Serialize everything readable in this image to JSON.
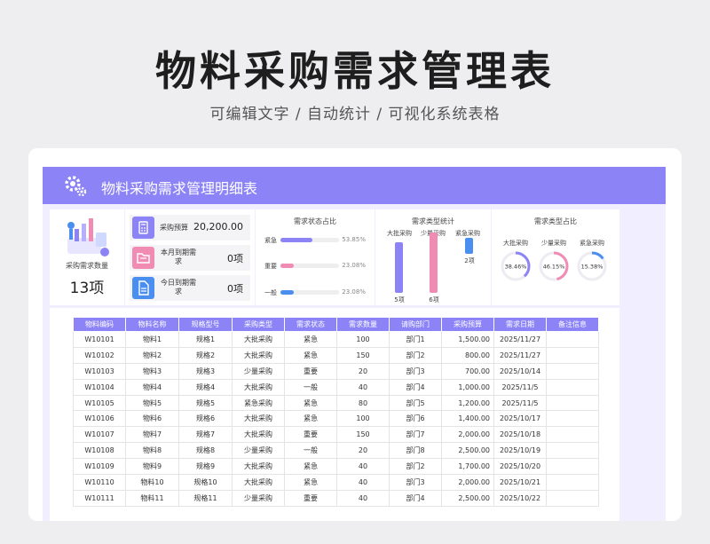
{
  "page": {
    "title": "物料采购需求管理表",
    "subtitle": "可编辑文字 / 自动统计 / 可视化系统表格"
  },
  "banner": {
    "title": "物料采购需求管理明细表"
  },
  "kpi": {
    "label": "采购需求数量",
    "value": "13项"
  },
  "stats": [
    {
      "label": "采购预算",
      "value": "20,200.00",
      "color": "#8c83f6",
      "icon": "calculator-icon"
    },
    {
      "label": "本月到期需求",
      "value": "0项",
      "color": "#f08bb4",
      "icon": "folder-icon"
    },
    {
      "label": "今日到期需求",
      "value": "0项",
      "color": "#4a8ff0",
      "icon": "document-icon"
    }
  ],
  "status_chart": {
    "title": "需求状态占比",
    "items": [
      {
        "label": "紧急",
        "percent": "53.85%",
        "value": 53.85,
        "color": "#8c83f6"
      },
      {
        "label": "重要",
        "percent": "23.08%",
        "value": 23.08,
        "color": "#f08bb4"
      },
      {
        "label": "一般",
        "percent": "23.08%",
        "value": 23.08,
        "color": "#4a8ff0"
      }
    ]
  },
  "type_chart": {
    "title": "需求类型统计",
    "items": [
      {
        "label": "大批采购",
        "count": 5,
        "value_label": "5项",
        "color": "#8c83f6"
      },
      {
        "label": "少量采购",
        "count": 6,
        "value_label": "6项",
        "color": "#f08bb4"
      },
      {
        "label": "紧急采购",
        "count": 2,
        "value_label": "2项",
        "color": "#4a8ff0"
      }
    ]
  },
  "type_ratio": {
    "title": "需求类型占比",
    "items": [
      {
        "label": "大批采购",
        "percent": "38.46%",
        "value": 38.46,
        "color": "#8c83f6"
      },
      {
        "label": "少量采购",
        "percent": "46.15%",
        "value": 46.15,
        "color": "#f08bb4"
      },
      {
        "label": "紧急采购",
        "percent": "15.38%",
        "value": 15.38,
        "color": "#4a8ff0"
      }
    ]
  },
  "table": {
    "headers": [
      "物料编码",
      "物料名称",
      "规格型号",
      "采购类型",
      "需求状态",
      "需求数量",
      "请购部门",
      "采购预算",
      "需求日期",
      "备注信息"
    ],
    "rows": [
      [
        "W10101",
        "物料1",
        "规格1",
        "大批采购",
        "紧急",
        "100",
        "部门1",
        "1,500.00",
        "2025/11/27",
        ""
      ],
      [
        "W10102",
        "物料2",
        "规格2",
        "大批采购",
        "紧急",
        "150",
        "部门2",
        "800.00",
        "2025/11/27",
        ""
      ],
      [
        "W10103",
        "物料3",
        "规格3",
        "少量采购",
        "重要",
        "20",
        "部门3",
        "700.00",
        "2025/10/14",
        ""
      ],
      [
        "W10104",
        "物料4",
        "规格4",
        "大批采购",
        "一般",
        "40",
        "部门4",
        "1,000.00",
        "2025/11/5",
        ""
      ],
      [
        "W10105",
        "物料5",
        "规格5",
        "紧急采购",
        "紧急",
        "80",
        "部门5",
        "1,200.00",
        "2025/11/5",
        ""
      ],
      [
        "W10106",
        "物料6",
        "规格6",
        "大批采购",
        "紧急",
        "100",
        "部门6",
        "1,400.00",
        "2025/10/17",
        ""
      ],
      [
        "W10107",
        "物料7",
        "规格7",
        "大批采购",
        "重要",
        "150",
        "部门7",
        "2,000.00",
        "2025/10/18",
        ""
      ],
      [
        "W10108",
        "物料8",
        "规格8",
        "少量采购",
        "一般",
        "20",
        "部门8",
        "2,500.00",
        "2025/10/19",
        ""
      ],
      [
        "W10109",
        "物料9",
        "规格9",
        "大批采购",
        "紧急",
        "40",
        "部门2",
        "1,700.00",
        "2025/10/20",
        ""
      ],
      [
        "W10110",
        "物料10",
        "规格10",
        "大批采购",
        "紧急",
        "40",
        "部门3",
        "2,000.00",
        "2025/10/21",
        ""
      ],
      [
        "W10111",
        "物料11",
        "规格11",
        "少量采购",
        "重要",
        "40",
        "部门4",
        "2,500.00",
        "2025/10/22",
        ""
      ]
    ]
  }
}
